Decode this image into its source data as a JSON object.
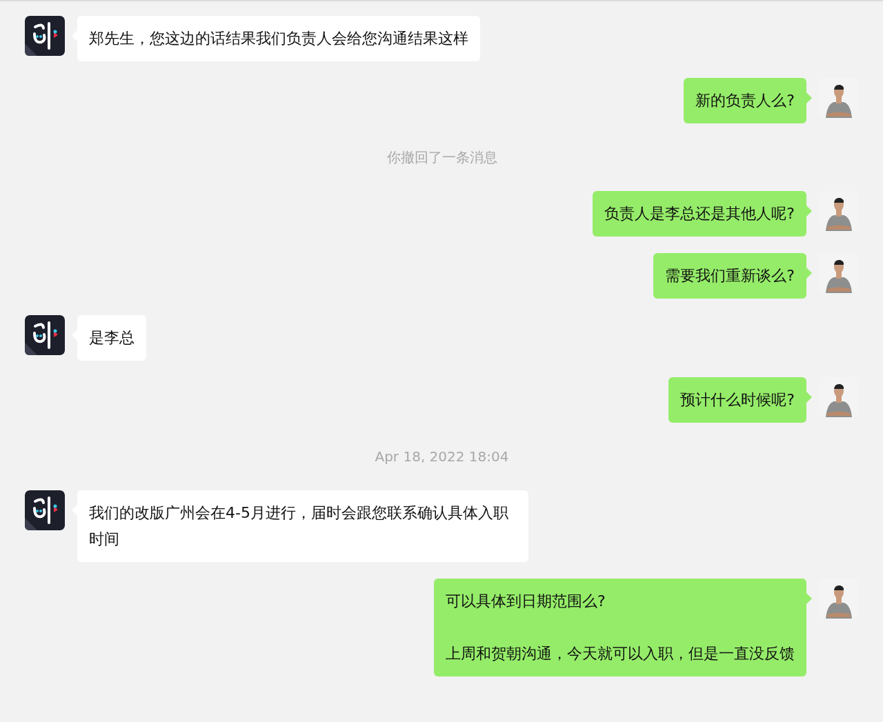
{
  "messages": [
    {
      "kind": "incoming",
      "lines": [
        "郑先生，您这边的话结果我们负责人会给您沟通结果这样"
      ]
    },
    {
      "kind": "outgoing",
      "lines": [
        "新的负责人么?"
      ]
    },
    {
      "kind": "notice",
      "lines": [
        "你撤回了一条消息"
      ]
    },
    {
      "kind": "outgoing",
      "lines": [
        "负责人是李总还是其他人呢?"
      ]
    },
    {
      "kind": "outgoing",
      "lines": [
        "需要我们重新谈么?"
      ]
    },
    {
      "kind": "incoming",
      "lines": [
        "是李总"
      ]
    },
    {
      "kind": "outgoing",
      "lines": [
        "预计什么时候呢?"
      ]
    },
    {
      "kind": "timestamp",
      "lines": [
        "Apr 18, 2022 18:04"
      ]
    },
    {
      "kind": "incoming",
      "lines": [
        "我们的改版广州会在4-5月进行，届时会跟您联系确认具体入职时间"
      ]
    },
    {
      "kind": "outgoing",
      "lines": [
        "可以具体到日期范围么?",
        "上周和贺朝沟通，今天就可以入职，但是一直没反馈"
      ]
    }
  ]
}
